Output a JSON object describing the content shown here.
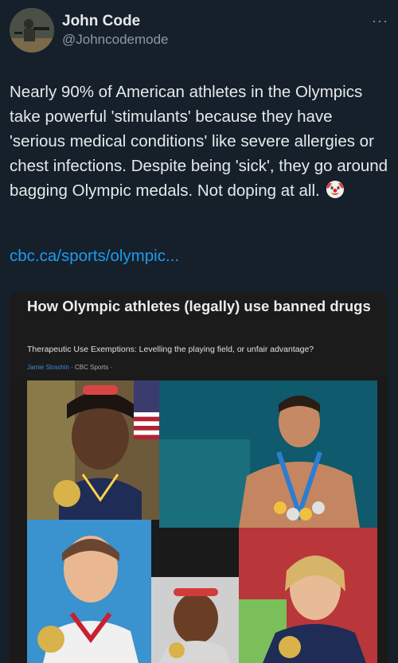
{
  "author": {
    "name": "John Code",
    "handle": "@Johncodemode"
  },
  "menu_icon": "more-options-icon",
  "tweet": {
    "text": "Nearly 90% of American athletes in the Olympics take powerful 'stimulants' because they have 'serious medical conditions' like severe allergies or chest infections. Despite being 'sick', they go around bagging Olympic medals. Not doping at all.",
    "emoji": "clown-face-icon",
    "link": "cbc.ca/sports/olympic..."
  },
  "card": {
    "title": "How Olympic athletes (legally) use banned drugs",
    "subtitle": "Therapeutic Use Exemptions: Levelling the playing field, or unfair advantage?",
    "byline_author": "Jamie Strashin",
    "byline_source": " · CBC Sports ·",
    "image_description_icon": "athletes-collage-image"
  },
  "colors": {
    "background": "#15202b",
    "link": "#1d9bf0",
    "muted": "#8b98a5"
  }
}
